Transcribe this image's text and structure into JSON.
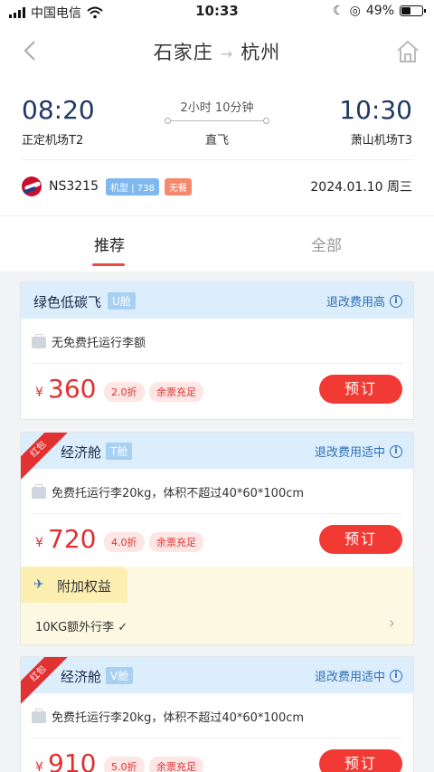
{
  "status_bar": {
    "carrier": "中国电信",
    "time": "10:33",
    "battery": "49%",
    "battery_level": 0.49
  },
  "header": {
    "origin": "石家庄",
    "destination": "杭州",
    "route_arrow": "→"
  },
  "flight": {
    "dep_time": "08:20",
    "arr_time": "10:30",
    "dep_airport": "正定机场T2",
    "arr_airport": "萧山机场T3",
    "duration": "2小时 10分钟",
    "stop_type": "直飞",
    "flight_no": "NS3215",
    "aircraft": "机型 | 738",
    "meal": "无餐",
    "date": "2024.01.10 周三"
  },
  "tabs": [
    {
      "label": "推荐"
    },
    {
      "label": "全部"
    }
  ],
  "cards": [
    {
      "cabin_name": "绿色低碳飞",
      "cabin_code": "U舱",
      "refund": "退改费用高",
      "baggage": "无免费托运行李额",
      "currency": "¥",
      "price": "360",
      "discount": "2.0折",
      "stock": "余票充足",
      "book": "预订"
    },
    {
      "ribbon": "红包",
      "cabin_name": "经济舱",
      "cabin_code": "T舱",
      "refund": "退改费用适中",
      "baggage": "免费托运行李20kg，体积不超过40*60*100cm",
      "currency": "¥",
      "price": "720",
      "discount": "4.0折",
      "stock": "余票充足",
      "book": "预订",
      "extra_title": "附加权益",
      "extra_item": "10KG额外行李 ✓"
    },
    {
      "ribbon": "红包",
      "cabin_name": "经济舱",
      "cabin_code": "V舱",
      "refund": "退改费用适中",
      "baggage": "免费托运行李20kg，体积不超过40*60*100cm",
      "currency": "¥",
      "price": "910",
      "discount": "5.0折",
      "stock": "余票充足",
      "book": "预订"
    }
  ]
}
